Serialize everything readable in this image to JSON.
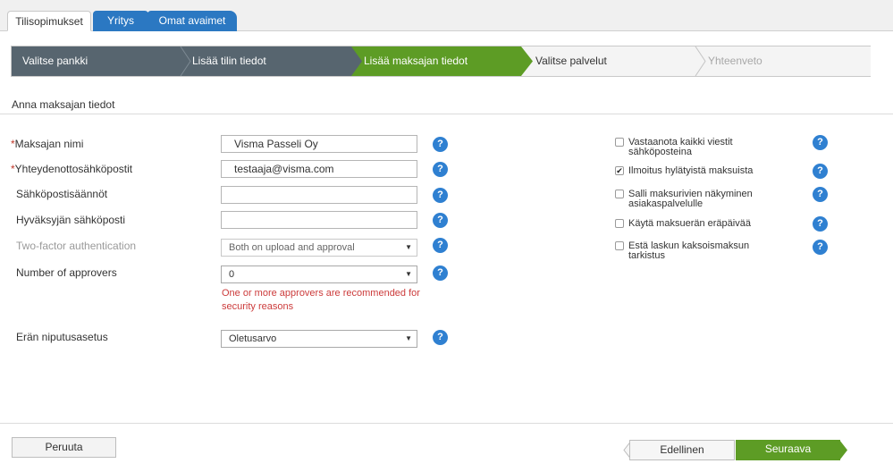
{
  "tabs": [
    {
      "label": "Tilisopimukset",
      "active": true
    },
    {
      "label": "Yritys",
      "active": false
    },
    {
      "label": "Omat avaimet",
      "active": false
    }
  ],
  "wizard": {
    "steps": [
      {
        "label": "Valitse pankki",
        "state": "completed"
      },
      {
        "label": "Lisää tilin tiedot",
        "state": "completed"
      },
      {
        "label": "Lisää maksajan tiedot",
        "state": "current"
      },
      {
        "label": "Valitse palvelut",
        "state": "upcoming"
      },
      {
        "label": "Yhteenveto",
        "state": "disabled"
      }
    ]
  },
  "section_title": "Anna maksajan tiedot",
  "form": {
    "payer_name": {
      "label": "Maksajan nimi",
      "required": "*",
      "value": "Visma Passeli Oy"
    },
    "contact_email": {
      "label": "Yhteydenottosähköpostit",
      "required": "*",
      "value": "testaaja@visma.com"
    },
    "email_rules": {
      "label": "Sähköpostisäännöt",
      "value": ""
    },
    "approver_email": {
      "label": "Hyväksyjän sähköposti",
      "value": ""
    },
    "two_factor": {
      "label": "Two-factor authentication",
      "value": "Both on upload and approval"
    },
    "num_approvers": {
      "label": "Number of approvers",
      "value": "0"
    },
    "approvers_warning": "One or more approvers are recommended for security reasons",
    "batch_setting": {
      "label": "Erän niputusasetus",
      "value": "Oletusarvo"
    },
    "help_symbol": "?",
    "caret_symbol": "▼"
  },
  "options": [
    {
      "label": "Vastaanota kaikki viestit sähköposteina",
      "checked": false
    },
    {
      "label": "Ilmoitus hylätyistä maksuista",
      "checked": true
    },
    {
      "label": "Salli maksurivien näkyminen asiakaspalvelulle",
      "checked": false
    },
    {
      "label": "Käytä maksuerän eräpäivää",
      "checked": false
    },
    {
      "label": "Estä laskun kaksoismaksun tarkistus",
      "checked": false
    }
  ],
  "buttons": {
    "cancel": "Peruuta",
    "previous": "Edellinen",
    "next": "Seuraava"
  },
  "colors": {
    "accent_blue": "#2b78c2",
    "step_dark": "#57656f",
    "step_green": "#5d9c25",
    "warning_red": "#cc3b3b"
  }
}
